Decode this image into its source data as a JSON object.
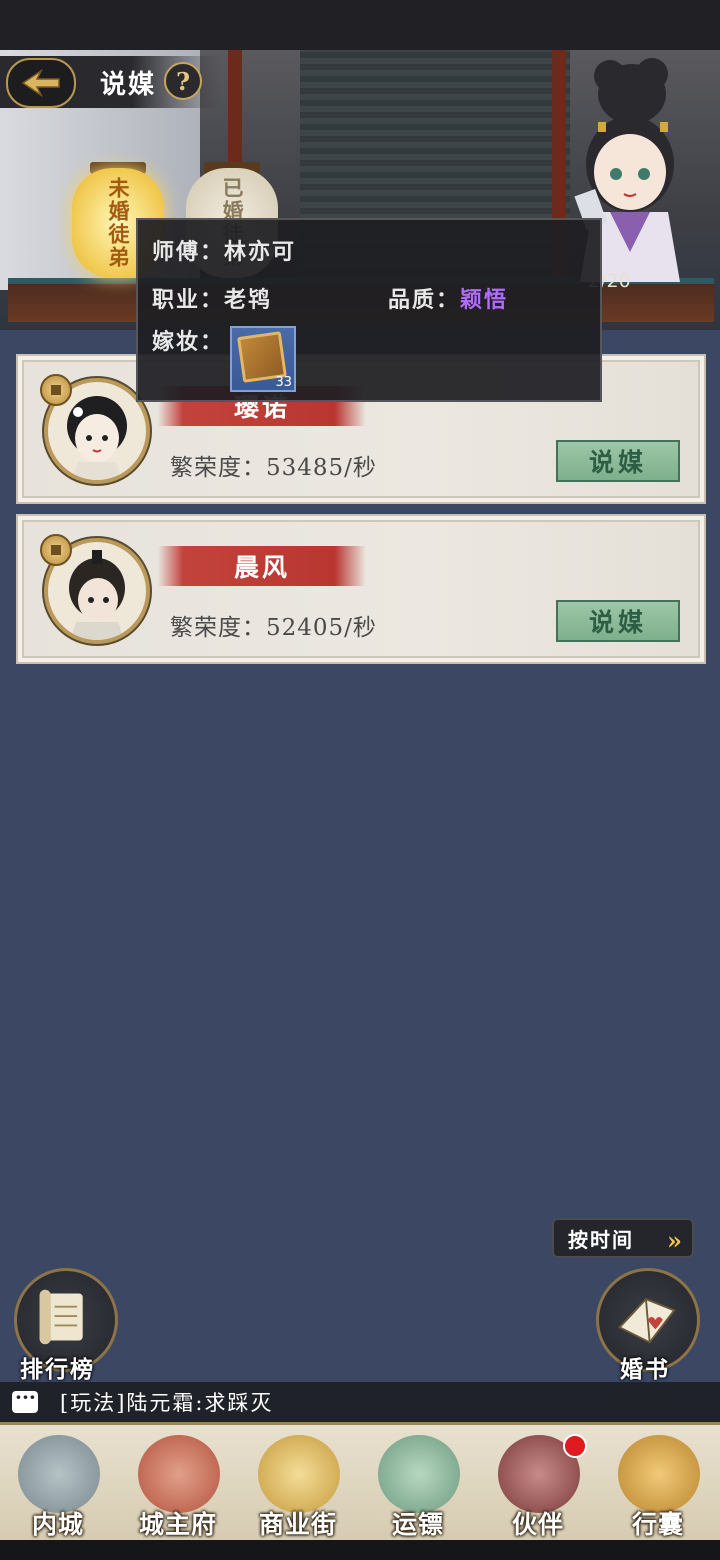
{
  "header": {
    "title": "说媒",
    "help_symbol": "?"
  },
  "lanterns": [
    {
      "label": "未婚徒弟",
      "active": true
    },
    {
      "label": "已婚徒弟",
      "active": false
    }
  ],
  "counter": "2/20",
  "popup": {
    "master_label": "师傅：",
    "master_value": "林亦可",
    "job_label": "职业：",
    "job_value": "老鸨",
    "quality_label": "品质：",
    "quality_value": "颖悟",
    "quality_color": "#b06bff",
    "dowry_label": "嫁妆：",
    "dowry_item": {
      "icon": "book-icon",
      "count": "33"
    }
  },
  "disciples": [
    {
      "name": "璎诺",
      "prosperity": "繁荣度：53485/秒",
      "button": "说媒"
    },
    {
      "name": "晨风",
      "prosperity": "繁荣度：52405/秒",
      "button": "说媒"
    }
  ],
  "sort_button": "按时间",
  "left_button": "排行榜",
  "right_button": "婚书",
  "chat": "[玩法]陆元霜:求踩灭",
  "nav": [
    "内城",
    "城主府",
    "商业街",
    "运镖",
    "伙伴",
    "行囊"
  ],
  "colors": {
    "accent_gold": "#c9a45b",
    "button_green": "#7eb08d",
    "ribbon_red": "#c2433c",
    "notification_red": "#e01b20"
  }
}
